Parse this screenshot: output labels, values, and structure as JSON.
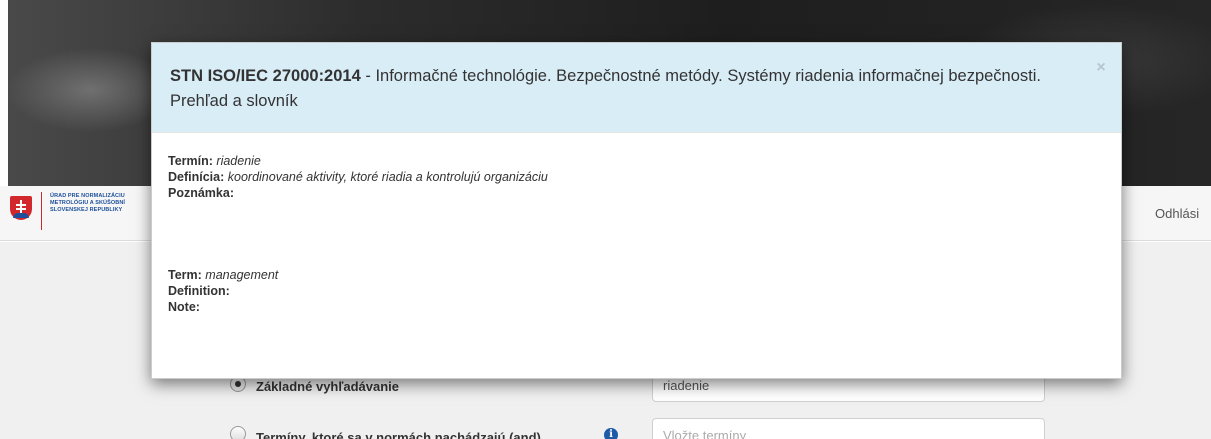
{
  "background": {
    "logo": {
      "lines": [
        "ÚRAD PRE NORMALIZÁCIU",
        "METROLÓGIU A SKÚŠOBNÍ",
        "SLOVENSKEJ REPUBLIKY"
      ]
    },
    "nav": {
      "logout_label": "Odhlási"
    },
    "search": {
      "option_basic_label": "Základné vyhľadávanie",
      "option_basic_selected": true,
      "option_and_label": "Termíny, ktoré sa v normách nachádzajú (and)",
      "option_and_selected": false,
      "basic_input_value": "riadenie",
      "and_input_placeholder": "Vložte termíny",
      "info_icon_glyph": "i"
    }
  },
  "modal": {
    "title_code": "STN ISO/IEC 27000:2014",
    "title_separator": " - ",
    "title_text": "Informačné technológie. Bezpečnostné metódy. Systémy riadenia informačnej bezpečnosti. Prehľad a slovník",
    "close_glyph": "×",
    "header_bg": "#d9edf7",
    "slovak": {
      "term_label": "Termín:",
      "term_value": "riadenie",
      "definition_label": "Definícia:",
      "definition_value": "koordinované aktivity, ktoré riadia a kontrolujú organizáciu",
      "note_label": "Poznámka:",
      "note_value": ""
    },
    "english": {
      "term_label": "Term:",
      "term_value": "management",
      "definition_label": "Definition:",
      "definition_value": "",
      "note_label": "Note:",
      "note_value": ""
    }
  }
}
